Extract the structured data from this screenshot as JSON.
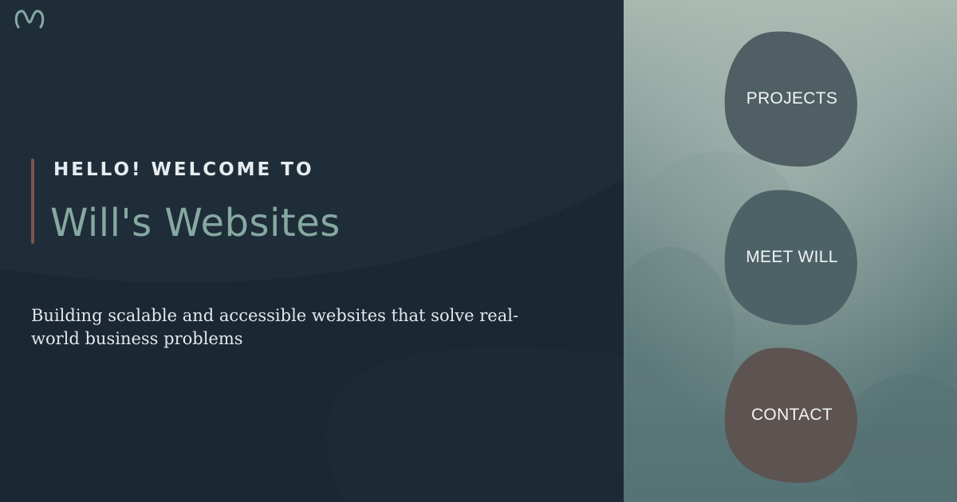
{
  "brand": {
    "logo_icon": "w-wave-logo-icon",
    "accent": "#86a9a1",
    "bar_color": "#7a5550"
  },
  "hero": {
    "eyebrow": "HELLO! WELCOME TO",
    "title": "Will's Websites",
    "tagline": "Building scalable and accessible websites that solve real-world business problems"
  },
  "nav": {
    "items": [
      {
        "label": "PROJECTS",
        "color": "#4f5f64"
      },
      {
        "label": "MEET WILL",
        "color": "#4c6266"
      },
      {
        "label": "CONTACT",
        "color": "#5d5351"
      }
    ]
  }
}
